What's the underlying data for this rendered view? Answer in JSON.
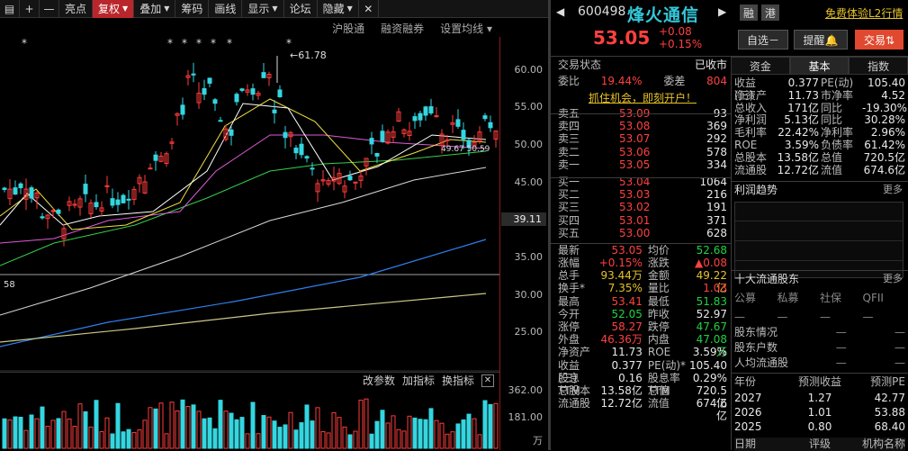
{
  "toolbar": {
    "items": [
      {
        "label": "▤",
        "sq": true
      },
      {
        "label": "+",
        "sq": true
      },
      {
        "label": "—",
        "sq": true
      },
      {
        "label": "亮点"
      },
      {
        "label": "复权",
        "caret": true,
        "active": true
      },
      {
        "label": "叠加",
        "caret": true
      },
      {
        "label": "筹码"
      },
      {
        "label": "画线"
      },
      {
        "label": "显示",
        "caret": true
      },
      {
        "label": "论坛"
      },
      {
        "label": "隐藏",
        "caret": true
      }
    ]
  },
  "sub_toolbar": [
    "沪股通",
    "融资融券",
    "设置均线 ▾"
  ],
  "chart": {
    "high_marker": "61.78",
    "left_marker": "58",
    "price_tag": "39.11",
    "y_ticks": [
      "60.00",
      "55.00",
      "50.00",
      "45.00",
      "40.00",
      "35.00",
      "30.00",
      "25.00"
    ],
    "vol_ticks": [
      "362.00",
      "181.00",
      "万"
    ],
    "tooltip_text": "49.67 50.59",
    "ind_toolbar": [
      "改参数",
      "加指标",
      "换指标"
    ]
  },
  "quote": {
    "code": "600498",
    "name": "烽火通信",
    "market1": "融",
    "market2": "港",
    "promo": "免费体验L2行情",
    "price": "53.05",
    "change": "+0.08",
    "change_pct": "+0.15%",
    "btn_watch": "自选－",
    "btn_alert": "提醒🔔",
    "btn_trade": "交易⇅",
    "state_label": "交易状态",
    "state_value": "已收市",
    "weibi_label": "委比",
    "weibi": "19.44%",
    "weicha_label": "委差",
    "weicha": "804",
    "ad_link": "抓住机会，即刻开户！",
    "sells": [
      {
        "label": "卖五",
        "price": "53.09",
        "vol": "93"
      },
      {
        "label": "卖四",
        "price": "53.08",
        "vol": "369"
      },
      {
        "label": "卖三",
        "price": "53.07",
        "vol": "292"
      },
      {
        "label": "卖二",
        "price": "53.06",
        "vol": "578"
      },
      {
        "label": "卖一",
        "price": "53.05",
        "vol": "334"
      }
    ],
    "buys": [
      {
        "label": "买一",
        "price": "53.04",
        "vol": "1064"
      },
      {
        "label": "买二",
        "price": "53.03",
        "vol": "216"
      },
      {
        "label": "买三",
        "price": "53.02",
        "vol": "191"
      },
      {
        "label": "买四",
        "price": "53.01",
        "vol": "371"
      },
      {
        "label": "买五",
        "price": "53.00",
        "vol": "628"
      }
    ],
    "stats": [
      {
        "l1": "最新",
        "v1": "53.05",
        "c1": "red",
        "l2": "均价",
        "v2": "52.68",
        "c2": "grn"
      },
      {
        "l1": "涨幅",
        "v1": "+0.15%",
        "c1": "red",
        "l2": "涨跌",
        "v2": "▲0.08",
        "c2": "red"
      },
      {
        "l1": "总手",
        "v1": "93.44万",
        "c1": "yel",
        "l2": "金额",
        "v2": "49.22亿",
        "c2": "yel"
      },
      {
        "l1": "换手*",
        "v1": "7.35%",
        "c1": "yel",
        "l2": "量比",
        "v2": "1.03",
        "c2": "red"
      },
      {
        "l1": "最高",
        "v1": "53.41",
        "c1": "red",
        "l2": "最低",
        "v2": "51.83",
        "c2": "grn"
      },
      {
        "l1": "今开",
        "v1": "52.05",
        "c1": "grn",
        "l2": "昨收",
        "v2": "52.97",
        "c2": "wht"
      },
      {
        "l1": "涨停",
        "v1": "58.27",
        "c1": "red",
        "l2": "跌停",
        "v2": "47.67",
        "c2": "grn"
      },
      {
        "l1": "外盘",
        "v1": "46.36万",
        "c1": "red",
        "l2": "内盘",
        "v2": "47.08万",
        "c2": "grn"
      },
      {
        "l1": "净资产",
        "v1": "11.73",
        "c1": "wht",
        "l2": "ROE",
        "v2": "3.59%",
        "c2": "wht"
      },
      {
        "l1": "收益(三)",
        "v1": "0.377",
        "c1": "wht",
        "l2": "PE(动)*",
        "v2": "105.40",
        "c2": "wht"
      },
      {
        "l1": "股息TTM",
        "v1": "0.16",
        "c1": "wht",
        "l2": "股息率TTM",
        "v2": "0.29%",
        "c2": "wht"
      },
      {
        "l1": "总股本",
        "v1": "13.58亿",
        "c1": "wht",
        "l2": "总值",
        "v2": "720.5亿",
        "c2": "wht"
      },
      {
        "l1": "流通股",
        "v1": "12.72亿",
        "c1": "wht",
        "l2": "流值",
        "v2": "674.6亿",
        "c2": "wht"
      }
    ]
  },
  "fund_tabs": [
    "资金",
    "基本",
    "指数"
  ],
  "fund": [
    {
      "l1": "收益(三)",
      "v1": "0.377",
      "l2": "PE(动)",
      "v2": "105.40"
    },
    {
      "l1": "净资产",
      "v1": "11.73",
      "l2": "市净率",
      "v2": "4.52"
    },
    {
      "l1": "总收入",
      "v1": "171亿",
      "l2": "同比",
      "v2": "-19.30%"
    },
    {
      "l1": "净利润",
      "v1": "5.13亿",
      "l2": "同比",
      "v2": "30.28%"
    },
    {
      "l1": "毛利率",
      "v1": "22.42%",
      "l2": "净利率",
      "v2": "2.96%"
    },
    {
      "l1": "ROE",
      "v1": "3.59%",
      "l2": "负债率",
      "v2": "61.42%"
    },
    {
      "l1": "总股本",
      "v1": "13.58亿",
      "l2": "总值",
      "v2": "720.5亿"
    },
    {
      "l1": "流通股",
      "v1": "12.72亿",
      "l2": "流值",
      "v2": "674.6亿"
    }
  ],
  "profit_trend": {
    "title": "利润趋势",
    "more": "更多"
  },
  "holders": {
    "title": "十大流通股东",
    "more": "更多",
    "cols": [
      "公募",
      "私募",
      "社保",
      "QFII"
    ],
    "rows": [
      {
        "label": "股东情况",
        "v": "—"
      },
      {
        "label": "股东户数",
        "v": "—"
      },
      {
        "label": "人均流通股",
        "v": "—"
      }
    ]
  },
  "forecast": {
    "header": [
      "年份",
      "预测收益",
      "预测PE"
    ],
    "rows": [
      [
        "2027",
        "1.27",
        "42.77"
      ],
      [
        "2026",
        "1.01",
        "53.88"
      ],
      [
        "2025",
        "0.80",
        "68.40"
      ]
    ],
    "footer": [
      "日期",
      "评级",
      "机构名称"
    ]
  }
}
